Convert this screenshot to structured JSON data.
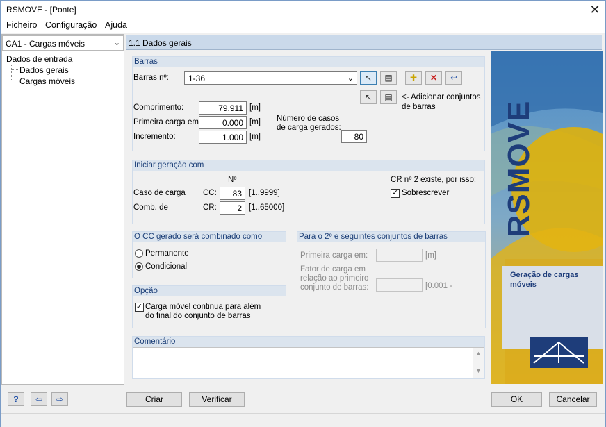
{
  "window": {
    "title": "RSMOVE - [Ponte]"
  },
  "menu": [
    "Ficheiro",
    "Configuração",
    "Ajuda"
  ],
  "sidebar": {
    "case_select": "CA1 - Cargas móveis",
    "tree_root": "Dados de entrada",
    "tree_items": [
      "Dados gerais",
      "Cargas móveis"
    ]
  },
  "header": {
    "title": "1.1 Dados gerais"
  },
  "barras": {
    "title": "Barras",
    "bars_label": "Barras nº:",
    "bars_value": "1-36",
    "add_sets_text": "<- Adicionar conjuntos\nde barras",
    "length_label": "Comprimento:",
    "length_value": "79.911",
    "length_unit": "[m]",
    "first_load_label": "Primeira carga em:",
    "first_load_value": "0.000",
    "first_load_unit": "[m]",
    "increment_label": "Incremento:",
    "increment_value": "1.000",
    "increment_unit": "[m]",
    "num_cases_label": "Número de casos\nde carga gerados:",
    "num_cases_value": "80"
  },
  "iniciar": {
    "title": "Iniciar geração com",
    "col_no": "Nº",
    "case_label": "Caso de carga",
    "cc_label": "CC:",
    "cc_value": "83",
    "cc_range": "[1..9999]",
    "comb_label": "Comb. de",
    "cr_label": "CR:",
    "cr_value": "2",
    "cr_range": "[1..65000]",
    "exists_text": "CR nº 2 existe, por isso:",
    "overwrite_label": "Sobrescrever",
    "overwrite_checked": true
  },
  "combinado": {
    "title": "O CC gerado será combinado como",
    "options": [
      "Permanente",
      "Condicional"
    ],
    "selected": "Condicional"
  },
  "opcao": {
    "title": "Opção",
    "checkbox_label": "Carga móvel continua para além\ndo final do conjunto de barras",
    "checked": true
  },
  "segundo": {
    "title": "Para o 2º e seguintes conjuntos de barras",
    "first_load_label": "Primeira carga em:",
    "first_load_unit": "[m]",
    "factor_label": "Fator de carga em\nrelação ao primeiro\nconjunto de barras:",
    "factor_range": "[0.001 -"
  },
  "comentario": {
    "title": "Comentário",
    "value": ""
  },
  "banner": {
    "brand": "RSMOVE",
    "caption": "Geração de cargas\nmóveis"
  },
  "buttons": {
    "criar": "Criar",
    "verificar": "Verificar",
    "ok": "OK",
    "cancel": "Cancelar"
  },
  "icons": [
    "help-icon",
    "import-icon",
    "export-icon",
    "pick-member-icon",
    "select-list-icon",
    "new-set-icon",
    "delete-icon",
    "reset-icon"
  ]
}
